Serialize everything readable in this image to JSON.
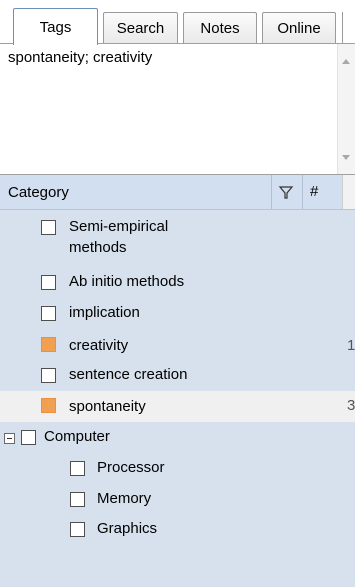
{
  "tabs": [
    {
      "label": "Tags",
      "active": true
    },
    {
      "label": "Search",
      "active": false
    },
    {
      "label": "Notes",
      "active": false
    },
    {
      "label": "Online",
      "active": false
    }
  ],
  "tags_field": {
    "value": "spontaneity; creativity"
  },
  "tree": {
    "header": {
      "category": "Category",
      "count": "#",
      "filter_icon": "filter-icon"
    },
    "items": [
      {
        "label_line1": "Semi-empirical",
        "label_line2": "methods",
        "tagged": false
      },
      {
        "label": "Ab initio methods",
        "tagged": false
      },
      {
        "label": "implication",
        "tagged": false
      },
      {
        "label": "creativity",
        "tagged": true,
        "count": "1"
      },
      {
        "label": "sentence creation",
        "tagged": false
      },
      {
        "label": "spontaneity",
        "tagged": true,
        "count": "3",
        "selected": true
      },
      {
        "label": "Computer",
        "tagged": false,
        "expanded": true
      },
      {
        "label": "Processor",
        "tagged": false
      },
      {
        "label": "Memory",
        "tagged": false
      },
      {
        "label": "Graphics",
        "tagged": false
      }
    ]
  },
  "colors": {
    "tagged": "#f0a050",
    "tree_bg": "#d6e1ed",
    "selected_row": "#f0f0f0"
  }
}
